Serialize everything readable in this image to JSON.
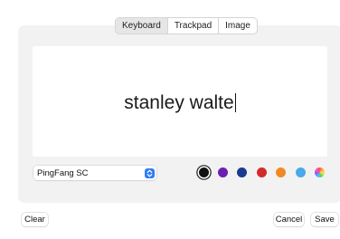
{
  "tabs": [
    {
      "label": "Keyboard",
      "selected": true
    },
    {
      "label": "Trackpad",
      "selected": false
    },
    {
      "label": "Image",
      "selected": false
    }
  ],
  "signature": {
    "text": "stanley walte"
  },
  "font_select": {
    "value": "PingFang SC",
    "icon": "chevron-updown-icon"
  },
  "colors": {
    "swatches": [
      "#111111",
      "#6b1fb1",
      "#1a3a8f",
      "#d42a2a",
      "#f08a24",
      "#4aa9e8",
      "rainbow"
    ],
    "selected": "#111111",
    "accent": "#2f7cf6"
  },
  "buttons": {
    "clear": "Clear",
    "cancel": "Cancel",
    "save": "Save"
  }
}
